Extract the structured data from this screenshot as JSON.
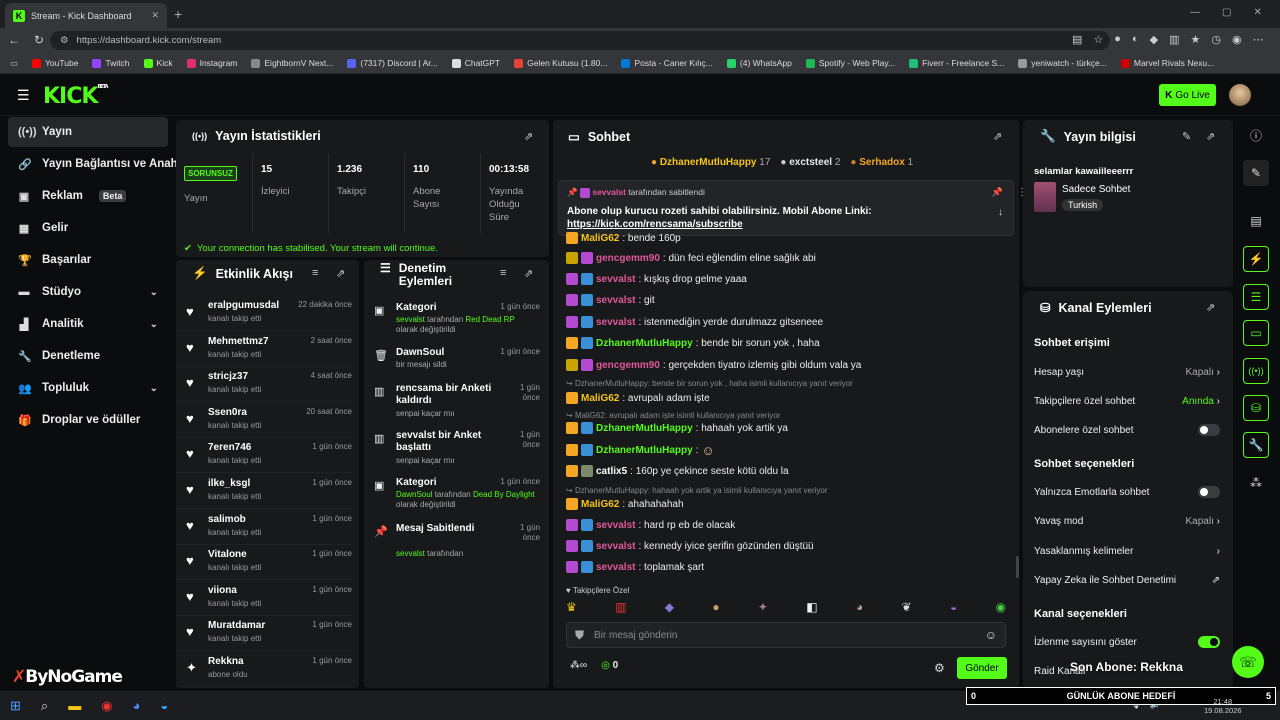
{
  "browser": {
    "tab_title": "Stream - Kick Dashboard",
    "url": "https://dashboard.kick.com/stream",
    "bookmarks": [
      "YouTube",
      "Twitch",
      "Kick",
      "Instagram",
      "EightbornV Next...",
      "(7317) Discord | Ar...",
      "ChatGPT",
      "Gelen Kutusu (1.80...",
      "Posta - Caner Kılıç...",
      "(4) WhatsApp",
      "Spotify - Web Play...",
      "Fiverr - Freelance S...",
      "yeniwatch - türkçe...",
      "Marvel Rivals Nexu..."
    ]
  },
  "header": {
    "logo": "KICK",
    "logo_tag": "BETA",
    "go_live": "Go Live"
  },
  "sidebar": {
    "items": [
      {
        "label": "Yayın"
      },
      {
        "label": "Yayın Bağlantısı ve Anahtarı"
      },
      {
        "label": "Reklam",
        "badge": "Beta"
      },
      {
        "label": "Gelir"
      },
      {
        "label": "Başarılar"
      },
      {
        "label": "Stüdyo"
      },
      {
        "label": "Analitik"
      },
      {
        "label": "Denetleme"
      },
      {
        "label": "Topluluk"
      },
      {
        "label": "Droplar ve ödüller"
      }
    ]
  },
  "stats": {
    "title": "Yayın İstatistikleri",
    "status_badge": "SORUNSUZ",
    "status_label": "Yayın",
    "viewers": "15",
    "viewers_label": "İzleyici",
    "followers": "1.236",
    "followers_label": "Takipçi",
    "subs": "110",
    "subs_label": "Abone Sayısı",
    "uptime": "00:13:58",
    "uptime_label": "Yayında Olduğu Süre",
    "notice": "Your connection has stabilised. Your stream will continue."
  },
  "feed": {
    "title": "Etkinlik Akışı",
    "items": [
      {
        "name": "eralpgumusdal",
        "sub": "kanalı takip etti",
        "time": "22 dakika önce"
      },
      {
        "name": "Mehmettmz7",
        "sub": "kanalı takip etti",
        "time": "2 saat önce"
      },
      {
        "name": "stricjz37",
        "sub": "kanalı takip etti",
        "time": "4 saat önce"
      },
      {
        "name": "Ssen0ra",
        "sub": "kanalı takip etti",
        "time": "20 saat önce"
      },
      {
        "name": "7eren746",
        "sub": "kanalı takip etti",
        "time": "1 gün önce"
      },
      {
        "name": "ilke_ksgl",
        "sub": "kanalı takip etti",
        "time": "1 gün önce"
      },
      {
        "name": "salimob",
        "sub": "kanalı takip etti",
        "time": "1 gün önce"
      },
      {
        "name": "Vitalone",
        "sub": "kanalı takip etti",
        "time": "1 gün önce"
      },
      {
        "name": "viiona",
        "sub": "kanalı takip etti",
        "time": "1 gün önce"
      },
      {
        "name": "Muratdamar",
        "sub": "kanalı takip etti",
        "time": "1 gün önce"
      },
      {
        "name": "Rekkna",
        "sub": "abone oldu",
        "time": "1 gün önce"
      }
    ]
  },
  "mod": {
    "title": "Denetim Eylemleri",
    "items": [
      {
        "name": "Kategori",
        "l1a": "sevvalst",
        "l1b": " tarafından ",
        "l1c": "Red Dead RP",
        "l2": "olarak değiştirildi",
        "time": "1 gün önce"
      },
      {
        "name": "DawnSoul",
        "l1a": "",
        "l1b": "bir mesajı sildi",
        "l1c": "",
        "l2": "",
        "time": "1 gün önce"
      },
      {
        "name": "rencsama bir Anketi kaldırdı",
        "l1a": "",
        "l1b": "senpai kaçar mıı",
        "l1c": "",
        "l2": "",
        "time": "1 gün önce"
      },
      {
        "name": "sevvalst bir Anket başlattı",
        "l1a": "",
        "l1b": "senpai kaçar mıı",
        "l1c": "",
        "l2": "",
        "time": "1 gün önce"
      },
      {
        "name": "Kategori",
        "l1a": "DawnSoul",
        "l1b": " tarafından ",
        "l1c": "Dead By Daylight",
        "l2": "olarak değiştirildi",
        "time": "1 gün önce"
      },
      {
        "name": "Mesaj Sabitlendi",
        "l1a": "sevvalst",
        "l1b": " tarafından",
        "l1c": "",
        "l2": "",
        "time": "1 gün önce"
      }
    ]
  },
  "chat": {
    "title": "Sohbet",
    "top_gifters": [
      {
        "name": "DzhanerMutluHappy",
        "count": "17"
      },
      {
        "name": "exctsteel",
        "count": "2"
      },
      {
        "name": "Serhadox",
        "count": "1"
      }
    ],
    "pinned_by": "sevvalst",
    "pinned_suffix": "tarafından sabitlendi",
    "pinned_text": "Abone olup kurucu rozeti sahibi olabilirsiniz. Mobil Abone Linki:",
    "pinned_link": "https://kick.com/rencsama/subscribe",
    "messages": [
      {
        "user": "MaliG62",
        "text": ": bende 160p"
      },
      {
        "user": "gencgemm90",
        "text": ": dün feci eğlendim eline sağlık abi"
      },
      {
        "user": "sevvalst",
        "text": ": kışkış drop gelme yaaa"
      },
      {
        "user": "sevvalst",
        "text": ": git"
      },
      {
        "user": "sevvalst",
        "text": ": istenmediğin yerde durulmazz gitseneee"
      },
      {
        "user": "DzhanerMutluHappy",
        "text": ": bende bir sorun yok , haha"
      },
      {
        "user": "gencgemm90",
        "text": ": gerçekden tiyatro izlemiş gibi oldum vala ya"
      },
      {
        "reply": "DzhanerMutluHappy: bende bir sorun yok , haha isimli kullanıcıya yanıt veriyor"
      },
      {
        "user": "MaliG62",
        "text": ": avrupalı adam işte"
      },
      {
        "reply": "MaliG62: avrupalı adam işte isimli kullanıcıya yanıt veriyor"
      },
      {
        "user": "DzhanerMutluHappy",
        "text": ": hahaah yok artik ya"
      },
      {
        "user": "DzhanerMutluHappy",
        "text": ":"
      },
      {
        "user": "catlix5",
        "text": ": 160p ye çekince seste kötü oldu la"
      },
      {
        "reply": "DzhanerMutluHappy: hahaah yok artik ya isimli kullanıcıya yanıt veriyor"
      },
      {
        "user": "MaliG62",
        "text": ": ahahahahah"
      },
      {
        "user": "sevvalst",
        "text": ": hard rp eb de olacak"
      },
      {
        "user": "sevvalst",
        "text": ": kennedy iyice şerifin gözünden düştüü"
      },
      {
        "user": "sevvalst",
        "text": ": toplamak şart"
      }
    ],
    "followers_only": "Takipçilere Özel",
    "input_placeholder": "Bir mesaj gönderin",
    "points": "0",
    "send": "Gönder"
  },
  "stream_info": {
    "title": "Yayın bilgisi",
    "stream_title": "selamlar kawaiileeerrr",
    "category": "Sadece Sohbet",
    "language": "Turkish"
  },
  "channel_actions": {
    "title": "Kanal Eylemleri",
    "chat_access": "Sohbet erişimi",
    "account_age": "Hesap yaşı",
    "account_age_val": "Kapalı",
    "followers_chat": "Takipçilere özel sohbet",
    "followers_chat_val": "Anında",
    "subs_chat": "Abonelere özel sohbet",
    "chat_options": "Sohbet seçenekleri",
    "emote_only": "Yalnızca Emotlarla sohbet",
    "slow_mode": "Yavaş mod",
    "slow_mode_val": "Kapalı",
    "banned_words": "Yasaklanmış kelimeler",
    "ai_mod": "Yapay Zeka ile Sohbet Denetimi",
    "channel_options": "Kanal seçenekleri",
    "show_viewers": "İzlenme sayısını göster",
    "raid": "Raid Kanalı"
  },
  "overlay": {
    "last_sub": "Son Abone: Rekkna",
    "goal_label": "GÜNLÜK ABONE HEDEFİ",
    "goal_current": "0",
    "goal_target": "5",
    "watermark": "ByNoGame"
  },
  "taskbar": {
    "time": "21:48",
    "date": "19.08.2026"
  }
}
